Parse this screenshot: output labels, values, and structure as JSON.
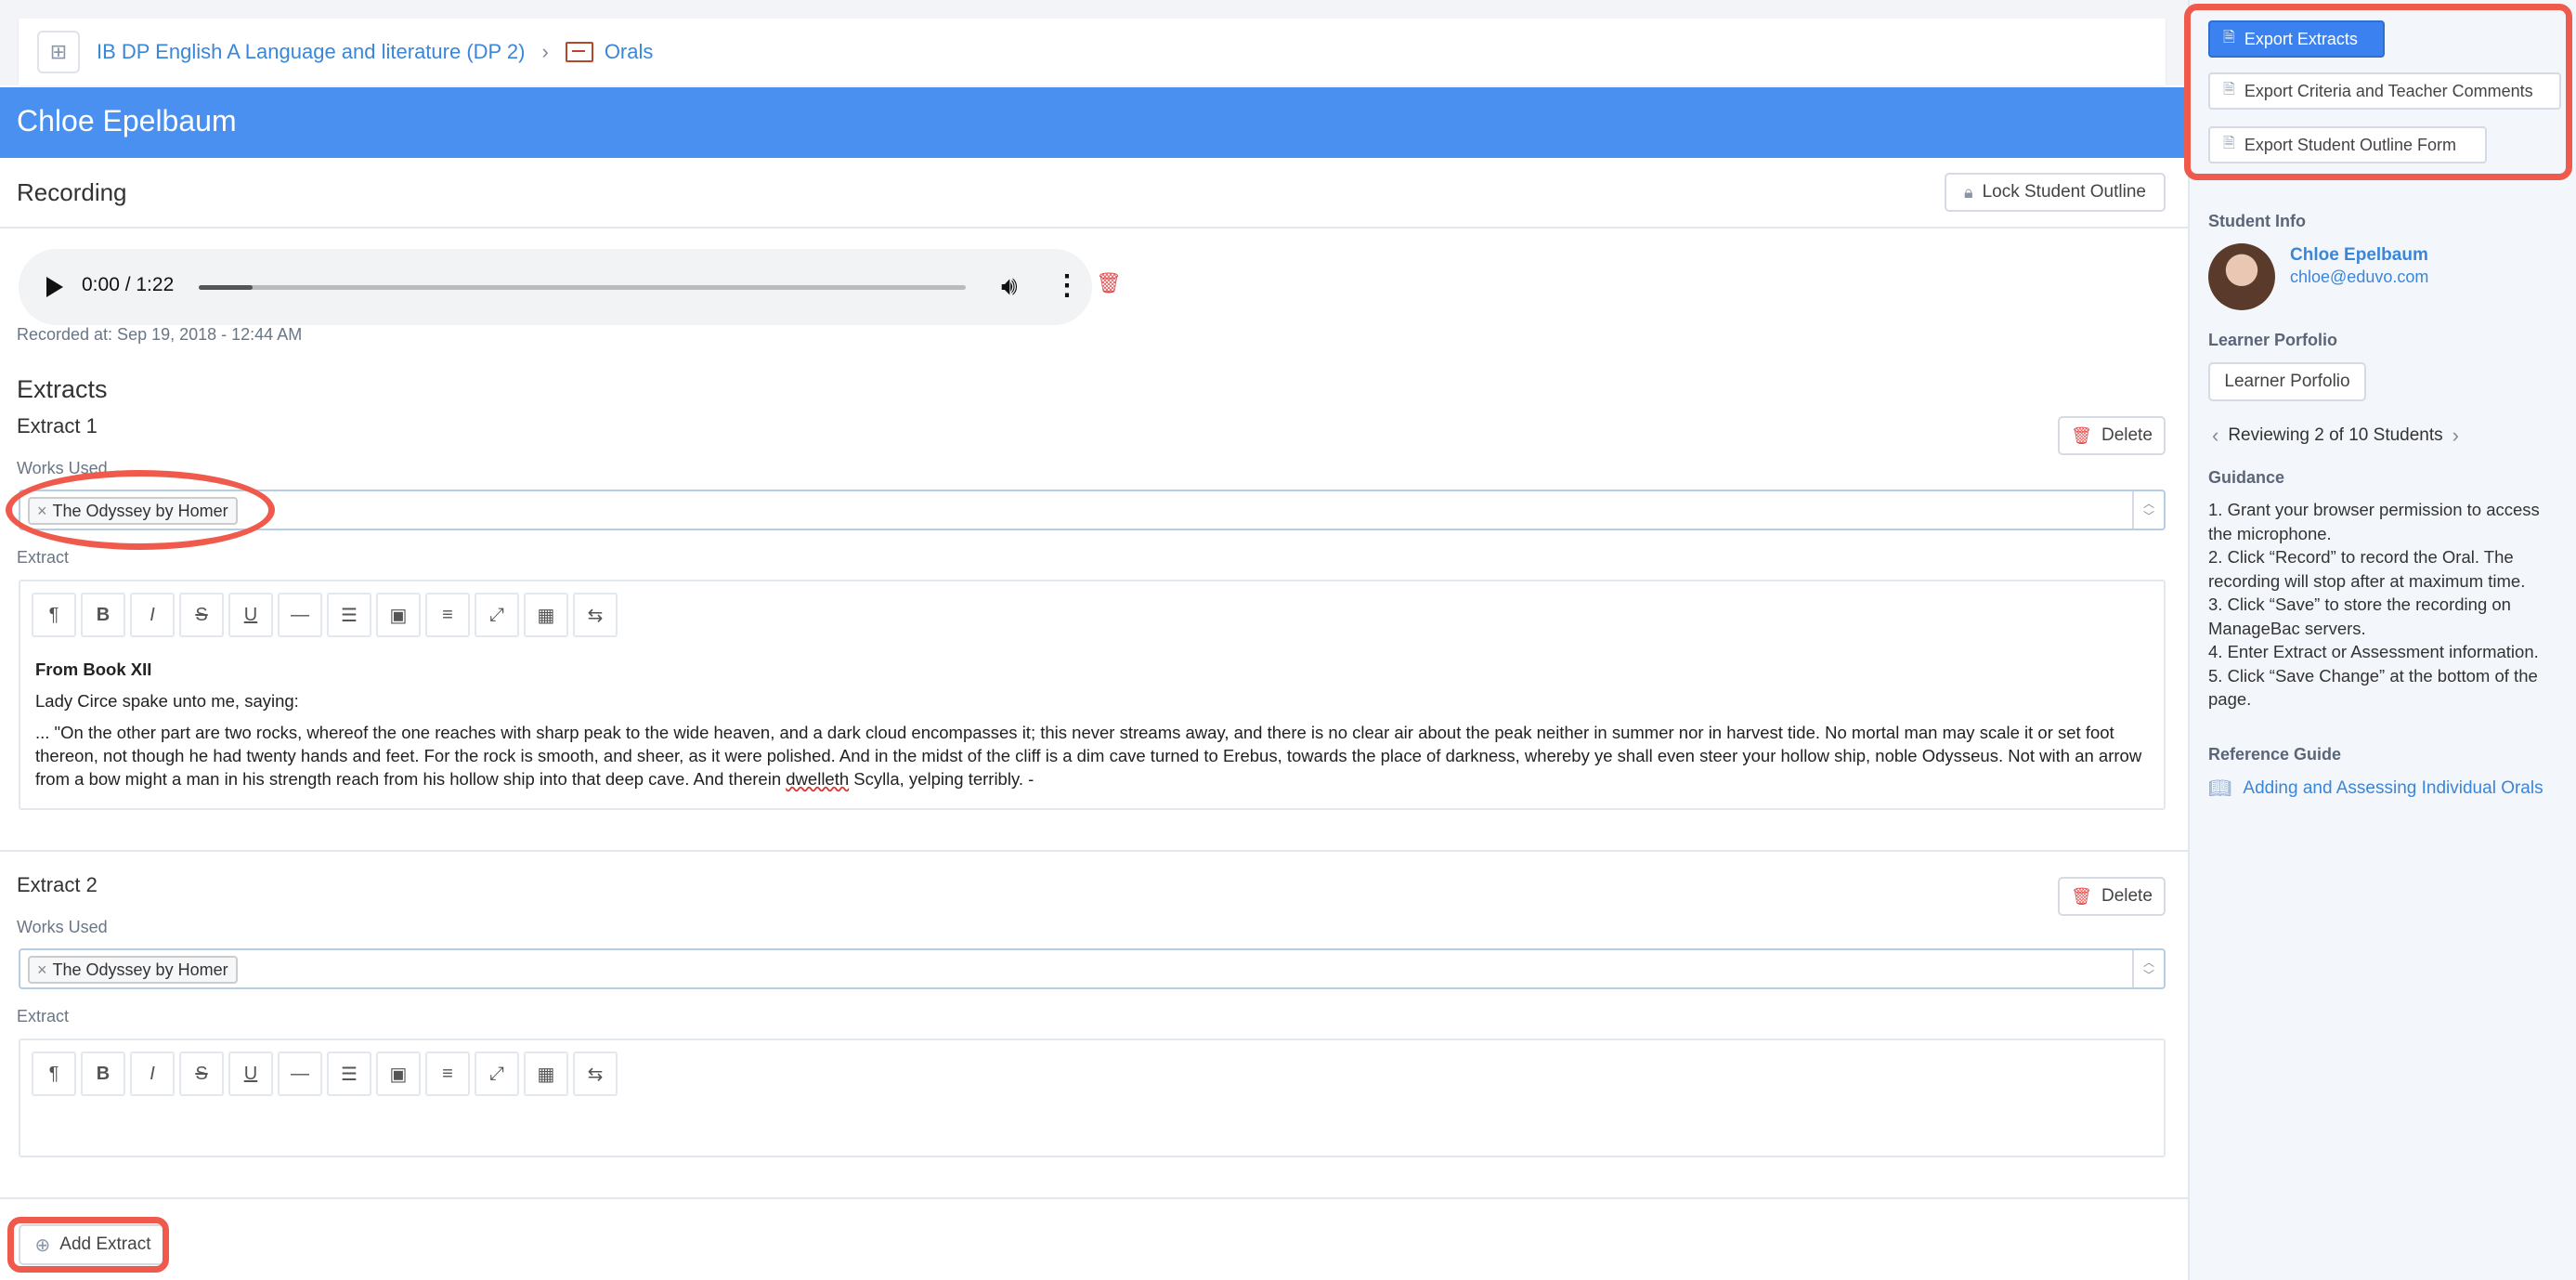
{
  "breadcrumb": {
    "course": "IB DP English A Language and literature (DP 2)",
    "separator": "›",
    "section": "Orals"
  },
  "student_banner": {
    "name": "Chloe Epelbaum"
  },
  "recording": {
    "title": "Recording",
    "lock_label": "Lock Student Outline",
    "time": "0:00 / 1:22",
    "progress": 0.07,
    "recorded_at": "Recorded at: Sep 19, 2018 - 12:44 AM"
  },
  "extracts": {
    "heading": "Extracts",
    "delete_label": "Delete",
    "works_used_label": "Works Used",
    "extract_label": "Extract",
    "items": [
      {
        "title": "Extract 1",
        "work": "The Odyssey by Homer",
        "body_heading": "From Book XII",
        "body_line1": "Lady Circe spake unto me, saying:",
        "body_para_a": "... \"On the other part are two rocks, whereof the one reaches with sharp peak to the wide heaven, and a dark cloud encompasses it; this never streams away, and there is no clear air about the peak neither in summer nor in harvest tide. No mortal man may scale it or set foot thereon, not though he had twenty hands and feet. For the rock is smooth, and sheer, as it were polished. And in the midst of the cliff is a dim cave turned to Erebus, towards the place of darkness, whereby ye shall even steer your hollow ship, noble Odysseus. Not with an arrow from a bow might a man in his strength reach from his hollow ship into that deep cave. And therein ",
        "body_squig": "dwelleth",
        "body_para_b": " Scylla, yelping terribly. -"
      },
      {
        "title": "Extract 2",
        "work": "The Odyssey by Homer"
      }
    ],
    "add_label": "Add Extract"
  },
  "toolbar": {
    "buttons": [
      "¶",
      "B",
      "I",
      "S",
      "U",
      "—",
      "☰",
      "▣",
      "≡",
      "⤢",
      "▦",
      "⇆"
    ]
  },
  "sidebar": {
    "export_extracts": "Export Extracts",
    "export_criteria": "Export Criteria and Teacher Comments",
    "export_outline": "Export Student Outline Form",
    "student_info_label": "Student Info",
    "student_name": "Chloe Epelbaum",
    "student_email": "chloe@eduvo.com",
    "learner_portfolio_label": "Learner Porfolio",
    "learner_portfolio_button": "Learner Porfolio",
    "reviewing": "Reviewing 2 of 10 Students",
    "guidance_label": "Guidance",
    "guidance": [
      "1. Grant your browser permission to access the microphone.",
      "2. Click “Record” to record the Oral. The recording will stop after at maximum time.",
      "3. Click “Save” to store the recording on ManageBac servers.",
      "4. Enter Extract or Assessment information.",
      "5. Click “Save Change” at the bottom of the page."
    ],
    "reference_label": "Reference Guide",
    "reference_link": "Adding and Assessing Individual Orals"
  },
  "colors": {
    "accent": "#4a90f0",
    "annotation": "#f05a4c",
    "link": "#3a86d8"
  }
}
